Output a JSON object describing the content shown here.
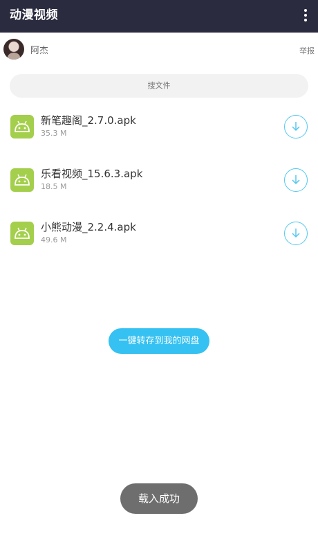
{
  "header": {
    "title": "动漫视频",
    "menu_icon": "more-vertical-icon"
  },
  "user": {
    "name": "阿杰",
    "report_label": "举报",
    "avatar_icon": "avatar"
  },
  "search": {
    "label": "搜文件"
  },
  "files": [
    {
      "name": "新笔趣阁_2.7.0.apk",
      "size": "35.3 M",
      "icon": "android-icon"
    },
    {
      "name": "乐看视频_15.6.3.apk",
      "size": "18.5 M",
      "icon": "android-icon"
    },
    {
      "name": "小熊动漫_2.2.4.apk",
      "size": "49.6 M",
      "icon": "android-icon"
    }
  ],
  "actions": {
    "save_all_label": "一键转存到我的网盘"
  },
  "toast": {
    "message": "载入成功"
  },
  "colors": {
    "header_bg": "#2b2b40",
    "accent": "#35c1f1",
    "apk_icon": "#a4cf4c",
    "toast_bg": "#6e6e6e"
  }
}
